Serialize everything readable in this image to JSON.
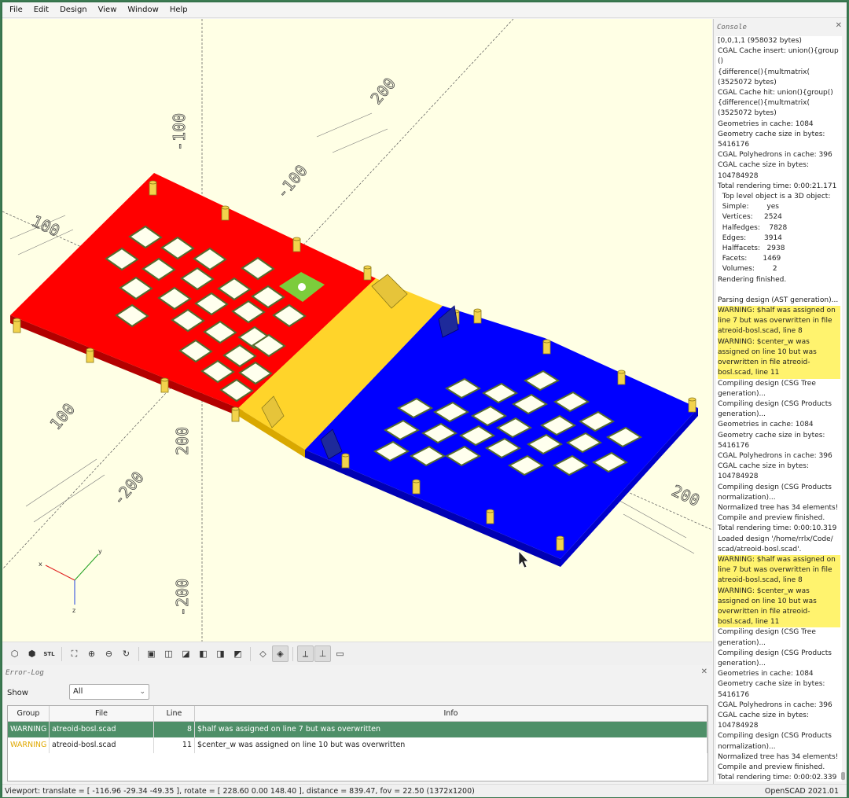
{
  "menubar": {
    "items": [
      "File",
      "Edit",
      "Design",
      "View",
      "Window",
      "Help"
    ]
  },
  "viewport": {
    "axis_labels": [
      "-100",
      "-200",
      "-100",
      "100",
      "200",
      "100",
      "200",
      "200",
      "-200"
    ],
    "gizmo": {
      "x": "x",
      "y": "y",
      "z": "z"
    }
  },
  "toolbar": {
    "buttons": [
      "render-icon",
      "preview-icon",
      "export-stl-icon",
      "zoom-all-icon",
      "zoom-in-icon",
      "zoom-out-icon",
      "reset-view-icon",
      "view-right-icon",
      "view-top-icon",
      "view-bottom-icon",
      "view-left-icon",
      "view-front-icon",
      "view-back-icon",
      "perspective-icon",
      "orthogonal-icon",
      "show-axes-icon",
      "show-scale-icon",
      "show-edges-icon"
    ],
    "stl_label": "STL"
  },
  "error_log": {
    "title": "Error-Log",
    "show_label": "Show",
    "show_value": "All",
    "columns": [
      "Group",
      "File",
      "Line",
      "Info"
    ],
    "rows": [
      {
        "group": "WARNING",
        "file": "atreoid-bosl.scad",
        "line": "8",
        "info": "$half was assigned on line 7 but was overwritten"
      },
      {
        "group": "WARNING",
        "file": "atreoid-bosl.scad",
        "line": "11",
        "info": "$center_w was assigned on line 10 but was overwritten"
      }
    ]
  },
  "statusbar": {
    "viewport_text": "Viewport: translate = [ -116.96 -29.34 -49.35 ], rotate = [ 228.60 0.00 148.40 ], distance = 839.47, fov = 22.50 (1372x1200)",
    "version": "OpenSCAD 2021.01"
  },
  "console": {
    "title": "Console",
    "lines": [
      {
        "text": "[0,0,1,1 (958032 bytes)",
        "hl": false
      },
      {
        "text": "CGAL Cache insert: union(){group()",
        "hl": false
      },
      {
        "text": "{difference(){multmatrix(",
        "hl": false
      },
      {
        "text": "(3525072 bytes)",
        "hl": false
      },
      {
        "text": "CGAL Cache hit: union(){group()",
        "hl": false
      },
      {
        "text": "{difference(){multmatrix(",
        "hl": false
      },
      {
        "text": "(3525072 bytes)",
        "hl": false
      },
      {
        "text": "Geometries in cache: 1084",
        "hl": false
      },
      {
        "text": "Geometry cache size in bytes:",
        "hl": false
      },
      {
        "text": "5416176",
        "hl": false
      },
      {
        "text": "CGAL Polyhedrons in cache: 396",
        "hl": false
      },
      {
        "text": "CGAL cache size in bytes:",
        "hl": false
      },
      {
        "text": "104784928",
        "hl": false
      },
      {
        "text": "Total rendering time: 0:00:21.171",
        "hl": false
      },
      {
        "text": "  Top level object is a 3D object:",
        "hl": false
      },
      {
        "text": "  Simple:        yes",
        "hl": false
      },
      {
        "text": "  Vertices:     2524",
        "hl": false
      },
      {
        "text": "  Halfedges:    7828",
        "hl": false
      },
      {
        "text": "  Edges:        3914",
        "hl": false
      },
      {
        "text": "  Halffacets:   2938",
        "hl": false
      },
      {
        "text": "  Facets:       1469",
        "hl": false
      },
      {
        "text": "  Volumes:        2",
        "hl": false
      },
      {
        "text": "Rendering finished.",
        "hl": false
      },
      {
        "text": "",
        "hl": false
      },
      {
        "text": "Parsing design (AST generation)...",
        "hl": false
      },
      {
        "text": "WARNING: $half was assigned on",
        "hl": true
      },
      {
        "text": "line 7 but was overwritten in file",
        "hl": true
      },
      {
        "text": "atreoid-bosl.scad, line 8",
        "hl": true
      },
      {
        "text": "WARNING: $center_w was",
        "hl": true
      },
      {
        "text": "assigned on line 10 but was",
        "hl": true
      },
      {
        "text": "overwritten in file atreoid-",
        "hl": true
      },
      {
        "text": "bosl.scad, line 11",
        "hl": true
      },
      {
        "text": "Compiling design (CSG Tree",
        "hl": false
      },
      {
        "text": "generation)...",
        "hl": false
      },
      {
        "text": "Compiling design (CSG Products",
        "hl": false
      },
      {
        "text": "generation)...",
        "hl": false
      },
      {
        "text": "Geometries in cache: 1084",
        "hl": false
      },
      {
        "text": "Geometry cache size in bytes:",
        "hl": false
      },
      {
        "text": "5416176",
        "hl": false
      },
      {
        "text": "CGAL Polyhedrons in cache: 396",
        "hl": false
      },
      {
        "text": "CGAL cache size in bytes:",
        "hl": false
      },
      {
        "text": "104784928",
        "hl": false
      },
      {
        "text": "Compiling design (CSG Products",
        "hl": false
      },
      {
        "text": "normalization)...",
        "hl": false
      },
      {
        "text": "Normalized tree has 34 elements!",
        "hl": false
      },
      {
        "text": "Compile and preview finished.",
        "hl": false
      },
      {
        "text": "Total rendering time: 0:00:10.319",
        "hl": false
      },
      {
        "text": "Loaded design '/home/rrlx/Code/",
        "hl": false
      },
      {
        "text": "scad/atreoid-bosl.scad'.",
        "hl": false
      },
      {
        "text": "WARNING: $half was assigned on",
        "hl": true
      },
      {
        "text": "line 7 but was overwritten in file",
        "hl": true
      },
      {
        "text": "atreoid-bosl.scad, line 8",
        "hl": true
      },
      {
        "text": "WARNING: $center_w was",
        "hl": true
      },
      {
        "text": "assigned on line 10 but was",
        "hl": true
      },
      {
        "text": "overwritten in file atreoid-",
        "hl": true
      },
      {
        "text": "bosl.scad, line 11",
        "hl": true
      },
      {
        "text": "Compiling design (CSG Tree",
        "hl": false
      },
      {
        "text": "generation)...",
        "hl": false
      },
      {
        "text": "Compiling design (CSG Products",
        "hl": false
      },
      {
        "text": "generation)...",
        "hl": false
      },
      {
        "text": "Geometries in cache: 1084",
        "hl": false
      },
      {
        "text": "Geometry cache size in bytes:",
        "hl": false
      },
      {
        "text": "5416176",
        "hl": false
      },
      {
        "text": "CGAL Polyhedrons in cache: 396",
        "hl": false
      },
      {
        "text": "CGAL cache size in bytes:",
        "hl": false
      },
      {
        "text": "104784928",
        "hl": false
      },
      {
        "text": "Compiling design (CSG Products",
        "hl": false
      },
      {
        "text": "normalization)...",
        "hl": false
      },
      {
        "text": "Normalized tree has 34 elements!",
        "hl": false
      },
      {
        "text": "Compile and preview finished.",
        "hl": false
      },
      {
        "text": "Total rendering time: 0:00:02.339",
        "hl": false
      }
    ]
  },
  "colors": {
    "red_plate": "#ff0000",
    "yellow_hinge": "#ffd42a",
    "blue_plate": "#0000ff",
    "green_pcb": "#7ccc3c",
    "peg": "#e8c84a",
    "viewport_bg": "#ffffe5",
    "selected_row": "#4e8f68",
    "highlight": "#fff36e"
  }
}
